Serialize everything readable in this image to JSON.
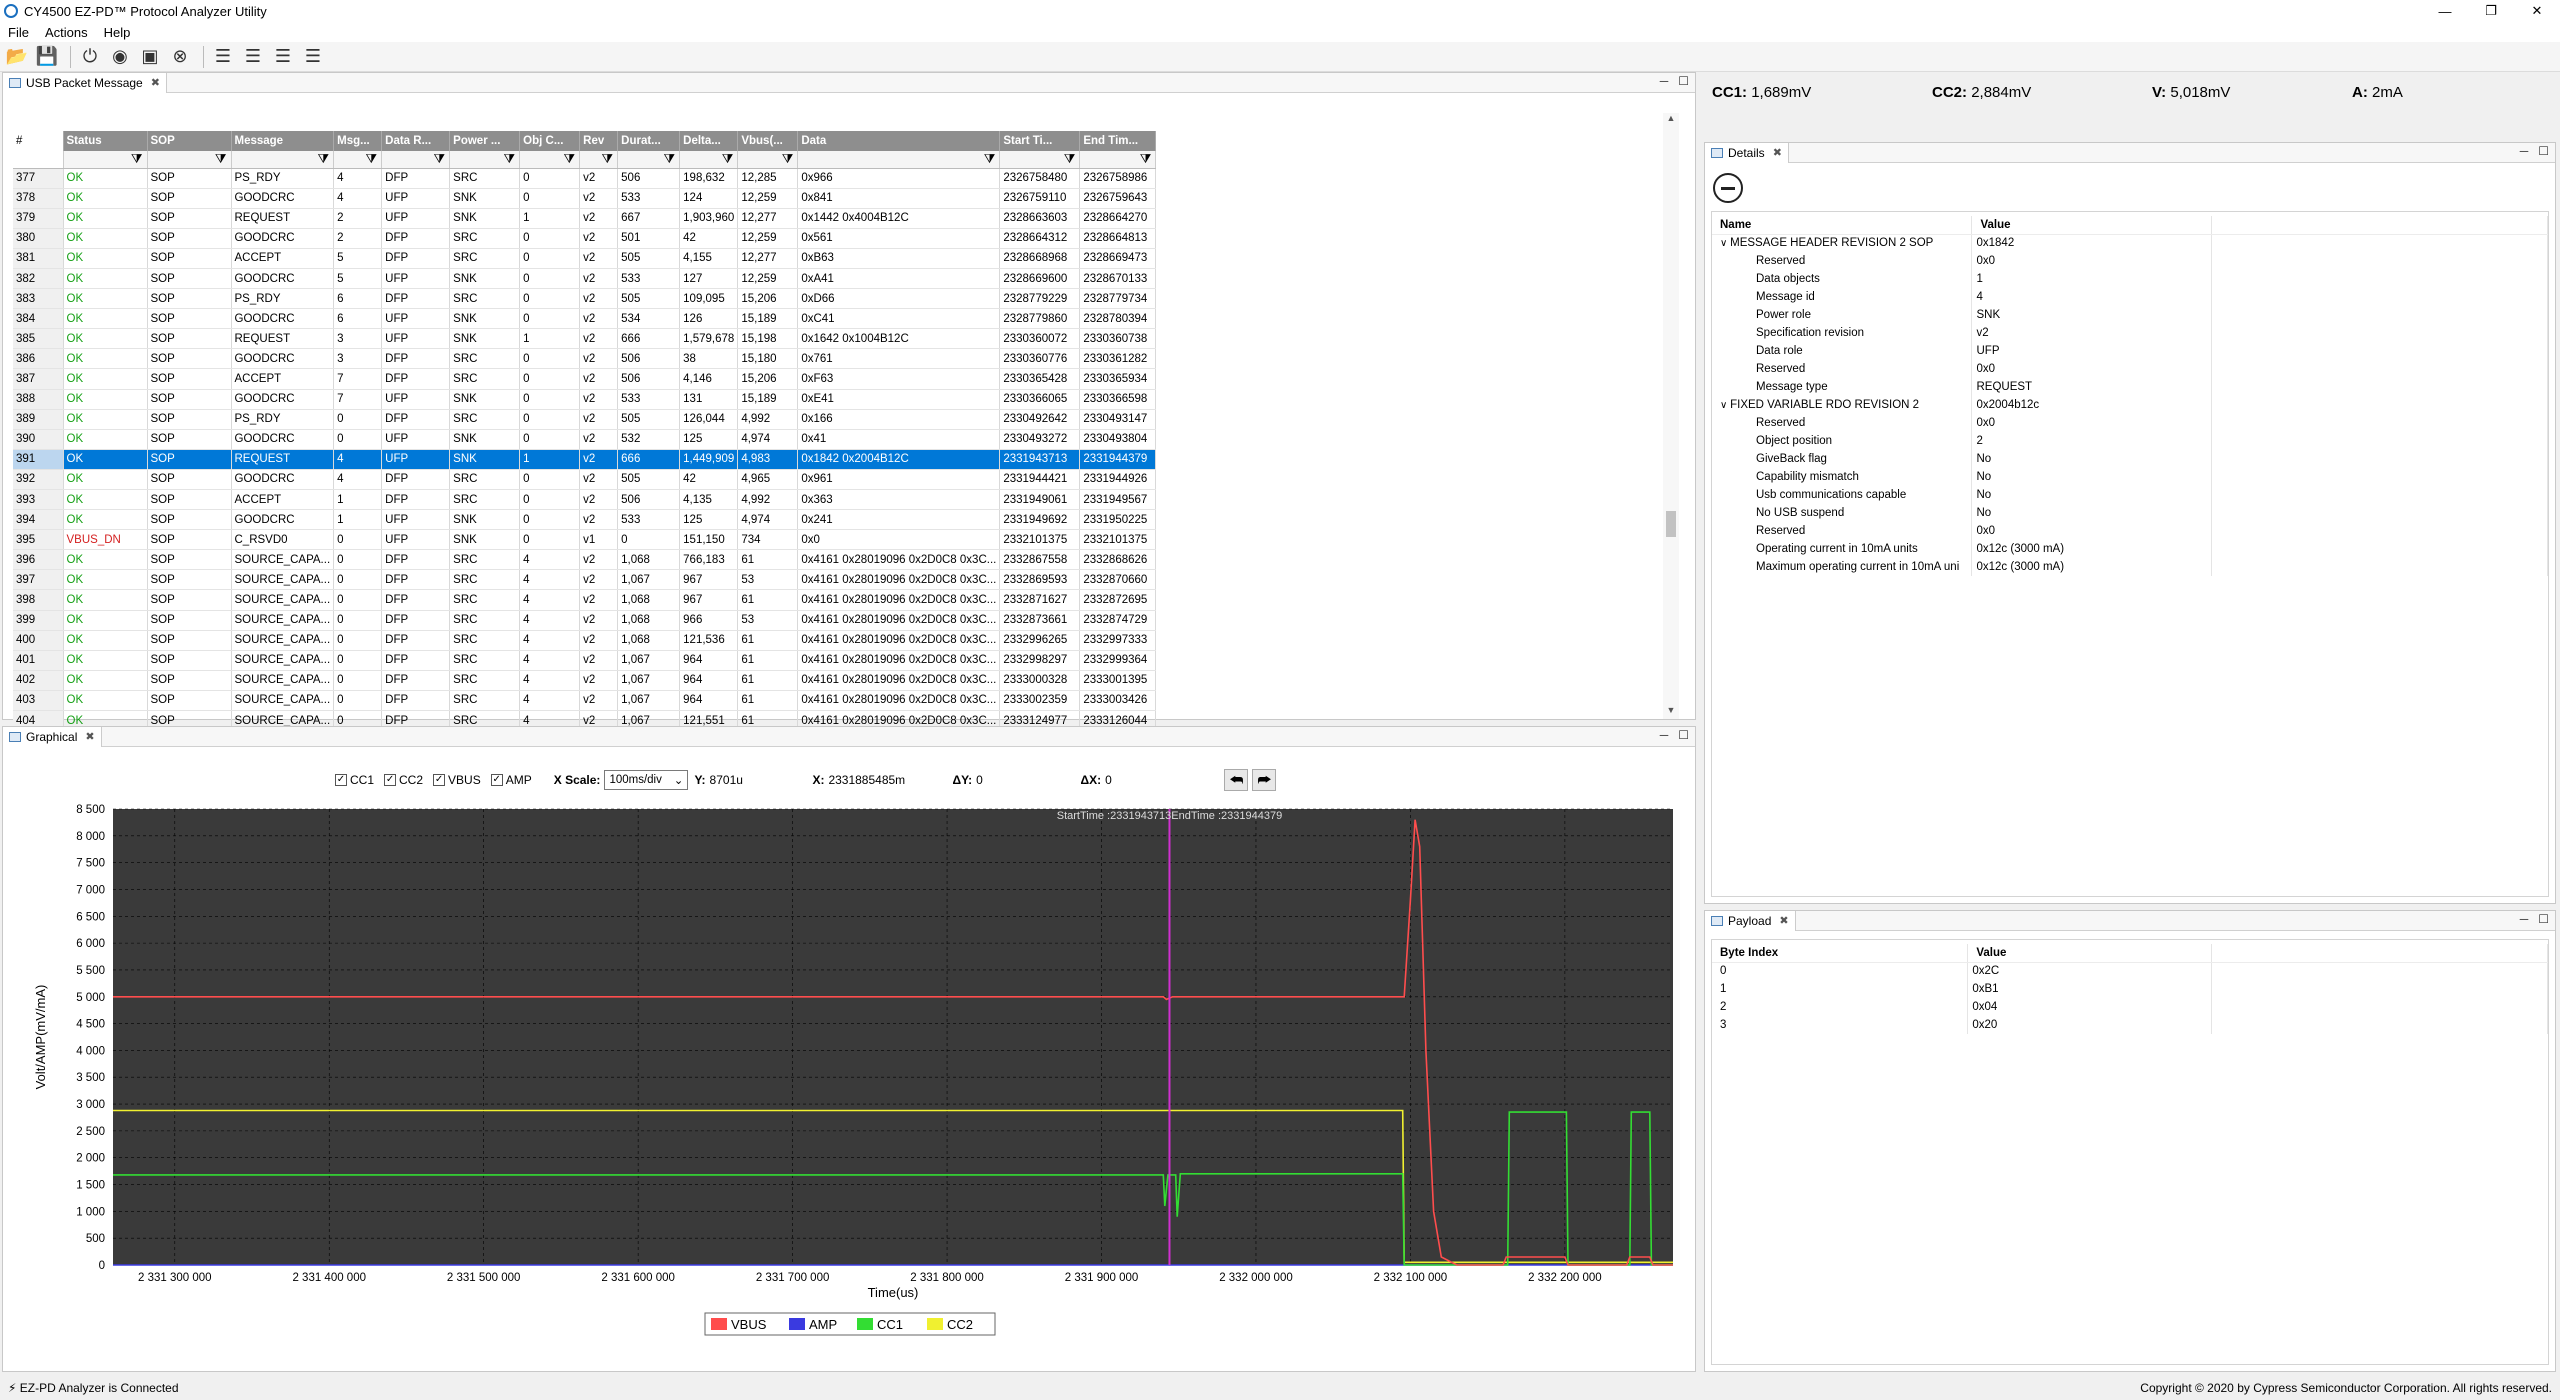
{
  "window": {
    "title": "CY4500 EZ-PD™ Protocol Analyzer Utility"
  },
  "menu": [
    "File",
    "Actions",
    "Help"
  ],
  "toolbar_icons": [
    "open-icon",
    "save-icon",
    "power-icon",
    "record-icon",
    "stop-icon",
    "clear-icon",
    "list-icon",
    "list-detail-icon",
    "list-summary-icon",
    "list-compact-icon"
  ],
  "measurements": {
    "cc1_label": "CC1:",
    "cc1": "1,689mV",
    "cc2_label": "CC2:",
    "cc2": "2,884mV",
    "v_label": "V:",
    "v": "5,018mV",
    "a_label": "A:",
    "a": "2mA"
  },
  "packets": {
    "tab": "USB Packet Message",
    "columns": [
      "#",
      "Status",
      "SOP",
      "Message",
      "Msg...",
      "Data R...",
      "Power ...",
      "Obj C...",
      "Rev",
      "Durat...",
      "Delta...",
      "Vbus(...",
      "Data",
      "Start Ti...",
      "End Tim..."
    ],
    "rows": [
      [
        "377",
        "OK",
        "SOP",
        "PS_RDY",
        "4",
        "DFP",
        "SRC",
        "0",
        "v2",
        "506",
        "198,632",
        "12,285",
        "0x966",
        "2326758480",
        "2326758986"
      ],
      [
        "378",
        "OK",
        "SOP",
        "GOODCRC",
        "4",
        "UFP",
        "SNK",
        "0",
        "v2",
        "533",
        "124",
        "12,259",
        "0x841",
        "2326759110",
        "2326759643"
      ],
      [
        "379",
        "OK",
        "SOP",
        "REQUEST",
        "2",
        "UFP",
        "SNK",
        "1",
        "v2",
        "667",
        "1,903,960",
        "12,277",
        "0x1442 0x4004B12C",
        "2328663603",
        "2328664270"
      ],
      [
        "380",
        "OK",
        "SOP",
        "GOODCRC",
        "2",
        "DFP",
        "SRC",
        "0",
        "v2",
        "501",
        "42",
        "12,259",
        "0x561",
        "2328664312",
        "2328664813"
      ],
      [
        "381",
        "OK",
        "SOP",
        "ACCEPT",
        "5",
        "DFP",
        "SRC",
        "0",
        "v2",
        "505",
        "4,155",
        "12,277",
        "0xB63",
        "2328668968",
        "2328669473"
      ],
      [
        "382",
        "OK",
        "SOP",
        "GOODCRC",
        "5",
        "UFP",
        "SNK",
        "0",
        "v2",
        "533",
        "127",
        "12,259",
        "0xA41",
        "2328669600",
        "2328670133"
      ],
      [
        "383",
        "OK",
        "SOP",
        "PS_RDY",
        "6",
        "DFP",
        "SRC",
        "0",
        "v2",
        "505",
        "109,095",
        "15,206",
        "0xD66",
        "2328779229",
        "2328779734"
      ],
      [
        "384",
        "OK",
        "SOP",
        "GOODCRC",
        "6",
        "UFP",
        "SNK",
        "0",
        "v2",
        "534",
        "126",
        "15,189",
        "0xC41",
        "2328779860",
        "2328780394"
      ],
      [
        "385",
        "OK",
        "SOP",
        "REQUEST",
        "3",
        "UFP",
        "SNK",
        "1",
        "v2",
        "666",
        "1,579,678",
        "15,198",
        "0x1642 0x1004B12C",
        "2330360072",
        "2330360738"
      ],
      [
        "386",
        "OK",
        "SOP",
        "GOODCRC",
        "3",
        "DFP",
        "SRC",
        "0",
        "v2",
        "506",
        "38",
        "15,180",
        "0x761",
        "2330360776",
        "2330361282"
      ],
      [
        "387",
        "OK",
        "SOP",
        "ACCEPT",
        "7",
        "DFP",
        "SRC",
        "0",
        "v2",
        "506",
        "4,146",
        "15,206",
        "0xF63",
        "2330365428",
        "2330365934"
      ],
      [
        "388",
        "OK",
        "SOP",
        "GOODCRC",
        "7",
        "UFP",
        "SNK",
        "0",
        "v2",
        "533",
        "131",
        "15,189",
        "0xE41",
        "2330366065",
        "2330366598"
      ],
      [
        "389",
        "OK",
        "SOP",
        "PS_RDY",
        "0",
        "DFP",
        "SRC",
        "0",
        "v2",
        "505",
        "126,044",
        "4,992",
        "0x166",
        "2330492642",
        "2330493147"
      ],
      [
        "390",
        "OK",
        "SOP",
        "GOODCRC",
        "0",
        "UFP",
        "SNK",
        "0",
        "v2",
        "532",
        "125",
        "4,974",
        "0x41",
        "2330493272",
        "2330493804"
      ],
      [
        "391",
        "OK",
        "SOP",
        "REQUEST",
        "4",
        "UFP",
        "SNK",
        "1",
        "v2",
        "666",
        "1,449,909",
        "4,983",
        "0x1842 0x2004B12C",
        "2331943713",
        "2331944379"
      ],
      [
        "392",
        "OK",
        "SOP",
        "GOODCRC",
        "4",
        "DFP",
        "SRC",
        "0",
        "v2",
        "505",
        "42",
        "4,965",
        "0x961",
        "2331944421",
        "2331944926"
      ],
      [
        "393",
        "OK",
        "SOP",
        "ACCEPT",
        "1",
        "DFP",
        "SRC",
        "0",
        "v2",
        "506",
        "4,135",
        "4,992",
        "0x363",
        "2331949061",
        "2331949567"
      ],
      [
        "394",
        "OK",
        "SOP",
        "GOODCRC",
        "1",
        "UFP",
        "SNK",
        "0",
        "v2",
        "533",
        "125",
        "4,974",
        "0x241",
        "2331949692",
        "2331950225"
      ],
      [
        "395",
        "VBUS_DN",
        "SOP",
        "C_RSVD0",
        "0",
        "UFP",
        "SNK",
        "0",
        "v1",
        "0",
        "151,150",
        "734",
        "0x0",
        "2332101375",
        "2332101375"
      ],
      [
        "396",
        "OK",
        "SOP",
        "SOURCE_CAPA...",
        "0",
        "DFP",
        "SRC",
        "4",
        "v2",
        "1,068",
        "766,183",
        "61",
        "0x4161 0x28019096 0x2D0C8 0x3C...",
        "2332867558",
        "2332868626"
      ],
      [
        "397",
        "OK",
        "SOP",
        "SOURCE_CAPA...",
        "0",
        "DFP",
        "SRC",
        "4",
        "v2",
        "1,067",
        "967",
        "53",
        "0x4161 0x28019096 0x2D0C8 0x3C...",
        "2332869593",
        "2332870660"
      ],
      [
        "398",
        "OK",
        "SOP",
        "SOURCE_CAPA...",
        "0",
        "DFP",
        "SRC",
        "4",
        "v2",
        "1,068",
        "967",
        "61",
        "0x4161 0x28019096 0x2D0C8 0x3C...",
        "2332871627",
        "2332872695"
      ],
      [
        "399",
        "OK",
        "SOP",
        "SOURCE_CAPA...",
        "0",
        "DFP",
        "SRC",
        "4",
        "v2",
        "1,068",
        "966",
        "53",
        "0x4161 0x28019096 0x2D0C8 0x3C...",
        "2332873661",
        "2332874729"
      ],
      [
        "400",
        "OK",
        "SOP",
        "SOURCE_CAPA...",
        "0",
        "DFP",
        "SRC",
        "4",
        "v2",
        "1,068",
        "121,536",
        "61",
        "0x4161 0x28019096 0x2D0C8 0x3C...",
        "2332996265",
        "2332997333"
      ],
      [
        "401",
        "OK",
        "SOP",
        "SOURCE_CAPA...",
        "0",
        "DFP",
        "SRC",
        "4",
        "v2",
        "1,067",
        "964",
        "61",
        "0x4161 0x28019096 0x2D0C8 0x3C...",
        "2332998297",
        "2332999364"
      ],
      [
        "402",
        "OK",
        "SOP",
        "SOURCE_CAPA...",
        "0",
        "DFP",
        "SRC",
        "4",
        "v2",
        "1,067",
        "964",
        "61",
        "0x4161 0x28019096 0x2D0C8 0x3C...",
        "2333000328",
        "2333001395"
      ],
      [
        "403",
        "OK",
        "SOP",
        "SOURCE_CAPA...",
        "0",
        "DFP",
        "SRC",
        "4",
        "v2",
        "1,067",
        "964",
        "61",
        "0x4161 0x28019096 0x2D0C8 0x3C...",
        "2333002359",
        "2333003426"
      ],
      [
        "404",
        "OK",
        "SOP",
        "SOURCE_CAPA...",
        "0",
        "DFP",
        "SRC",
        "4",
        "v2",
        "1,067",
        "121,551",
        "61",
        "0x4161 0x28019096 0x2D0C8 0x3C...",
        "2333124977",
        "2333126044"
      ]
    ],
    "selected_row": "391"
  },
  "graphical": {
    "tab": "Graphical",
    "checkboxes": [
      "CC1",
      "CC2",
      "VBUS",
      "AMP"
    ],
    "xscale_label": "X Scale:",
    "xscale_value": "100ms/div",
    "y_label": "Y:",
    "y_value": "8701u",
    "x_label": "X:",
    "x_value": "2331885485m",
    "dy_label": "ΔY:",
    "dy_value": "0",
    "dx_label": "ΔX:",
    "dx_value": "0"
  },
  "details": {
    "tab": "Details",
    "headers": [
      "Name",
      "Value"
    ],
    "rows": [
      {
        "name": "MESSAGE HEADER REVISION 2 SOP",
        "value": "0x1842",
        "level": 0
      },
      {
        "name": "Reserved",
        "value": "0x0",
        "level": 1
      },
      {
        "name": "Data objects",
        "value": "1",
        "level": 1
      },
      {
        "name": "Message id",
        "value": "4",
        "level": 1
      },
      {
        "name": "Power role",
        "value": "SNK",
        "level": 1
      },
      {
        "name": "Specification revision",
        "value": "v2",
        "level": 1
      },
      {
        "name": "Data role",
        "value": "UFP",
        "level": 1
      },
      {
        "name": "Reserved",
        "value": "0x0",
        "level": 1
      },
      {
        "name": "Message type",
        "value": "REQUEST",
        "level": 1
      },
      {
        "name": "FIXED VARIABLE RDO REVISION 2",
        "value": "0x2004b12c",
        "level": 0
      },
      {
        "name": "Reserved",
        "value": "0x0",
        "level": 1
      },
      {
        "name": "Object position",
        "value": "2",
        "level": 1
      },
      {
        "name": "GiveBack flag",
        "value": "No",
        "level": 1
      },
      {
        "name": "Capability mismatch",
        "value": "No",
        "level": 1
      },
      {
        "name": "Usb communications capable",
        "value": "No",
        "level": 1
      },
      {
        "name": "No USB suspend",
        "value": "No",
        "level": 1
      },
      {
        "name": "Reserved",
        "value": "0x0",
        "level": 1
      },
      {
        "name": "Operating current in 10mA units",
        "value": "0x12c (3000 mA)",
        "level": 1
      },
      {
        "name": "Maximum operating current in 10mA uni",
        "value": "0x12c (3000 mA)",
        "level": 1
      }
    ]
  },
  "payload": {
    "tab": "Payload",
    "headers": [
      "Byte Index",
      "Value"
    ],
    "rows": [
      [
        "0",
        "0x2C"
      ],
      [
        "1",
        "0xB1"
      ],
      [
        "2",
        "0x04"
      ],
      [
        "3",
        "0x20"
      ]
    ]
  },
  "status": {
    "left": "EZ-PD Analyzer is Connected",
    "right": "Copyright © 2020 by Cypress Semiconductor Corporation. All rights reserved."
  },
  "colors": {
    "vbus": "#ff4d4d",
    "amp": "#3a3ae0",
    "cc1": "#33dd33",
    "cc2": "#f0f030",
    "marker": "#d030d0",
    "plot_bg": "#3a3a3a",
    "selection": "#0078d7",
    "ok": "#16a016",
    "error": "#d42020"
  },
  "chart_data": {
    "type": "line",
    "title": "",
    "annotation": "StartTime :2331943713EndTime :2331944379",
    "xlabel": "Time(us)",
    "ylabel": "Volt/AMP(mV/mA)",
    "xlim": [
      2331260000,
      2332270000
    ],
    "ylim": [
      0,
      8500
    ],
    "xticks": [
      2331300000,
      2331400000,
      2331500000,
      2331600000,
      2331700000,
      2331800000,
      2331900000,
      2332000000,
      2332100000,
      2332200000
    ],
    "xtick_labels": [
      "2 331 300 000",
      "2 331 400 000",
      "2 331 500 000",
      "2 331 600 000",
      "2 331 700 000",
      "2 331 800 000",
      "2 331 900 000",
      "2 332 000 000",
      "2 332 100 000",
      "2 332 200 000"
    ],
    "yticks": [
      0,
      500,
      1000,
      1500,
      2000,
      2500,
      3000,
      3500,
      4000,
      4500,
      5000,
      5500,
      6000,
      6500,
      7000,
      7500,
      8000,
      8500
    ],
    "ytick_labels": [
      "0",
      "500",
      "1 000",
      "1 500",
      "2 000",
      "2 500",
      "3 000",
      "3 500",
      "4 000",
      "4 500",
      "5 000",
      "5 500",
      "6 000",
      "6 500",
      "7 000",
      "7 500",
      "8 000",
      "8 500"
    ],
    "grid": true,
    "legend": "bottom-center",
    "marker_x": 2331944000,
    "series": [
      {
        "name": "VBUS",
        "points": [
          [
            2331260000,
            5000
          ],
          [
            2331940000,
            5000
          ],
          [
            2331942000,
            4950
          ],
          [
            2331946000,
            5000
          ],
          [
            2332096000,
            5000
          ],
          [
            2332100000,
            6800
          ],
          [
            2332103000,
            8300
          ],
          [
            2332106000,
            7800
          ],
          [
            2332110000,
            4000
          ],
          [
            2332115000,
            1000
          ],
          [
            2332120000,
            150
          ],
          [
            2332130000,
            0
          ],
          [
            2332160000,
            0
          ],
          [
            2332162000,
            150
          ],
          [
            2332200000,
            150
          ],
          [
            2332202000,
            0
          ],
          [
            2332240000,
            0
          ],
          [
            2332242000,
            150
          ],
          [
            2332255000,
            150
          ],
          [
            2332257000,
            0
          ],
          [
            2332270000,
            0
          ]
        ]
      },
      {
        "name": "AMP",
        "points": [
          [
            2331260000,
            0
          ],
          [
            2332270000,
            0
          ]
        ]
      },
      {
        "name": "CC1",
        "points": [
          [
            2331260000,
            1680
          ],
          [
            2331940000,
            1680
          ],
          [
            2331941000,
            1100
          ],
          [
            2331943000,
            1680
          ],
          [
            2331948000,
            1680
          ],
          [
            2331949000,
            900
          ],
          [
            2331951000,
            1700
          ],
          [
            2332095000,
            1700
          ],
          [
            2332096000,
            0
          ],
          [
            2332163000,
            0
          ],
          [
            2332164000,
            2850
          ],
          [
            2332201000,
            2850
          ],
          [
            2332202000,
            0
          ],
          [
            2332242000,
            0
          ],
          [
            2332243000,
            2850
          ],
          [
            2332255000,
            2850
          ],
          [
            2332256000,
            0
          ],
          [
            2332270000,
            0
          ]
        ]
      },
      {
        "name": "CC2",
        "points": [
          [
            2331260000,
            2880
          ],
          [
            2332095000,
            2880
          ],
          [
            2332096000,
            50
          ],
          [
            2332270000,
            50
          ]
        ]
      }
    ]
  }
}
